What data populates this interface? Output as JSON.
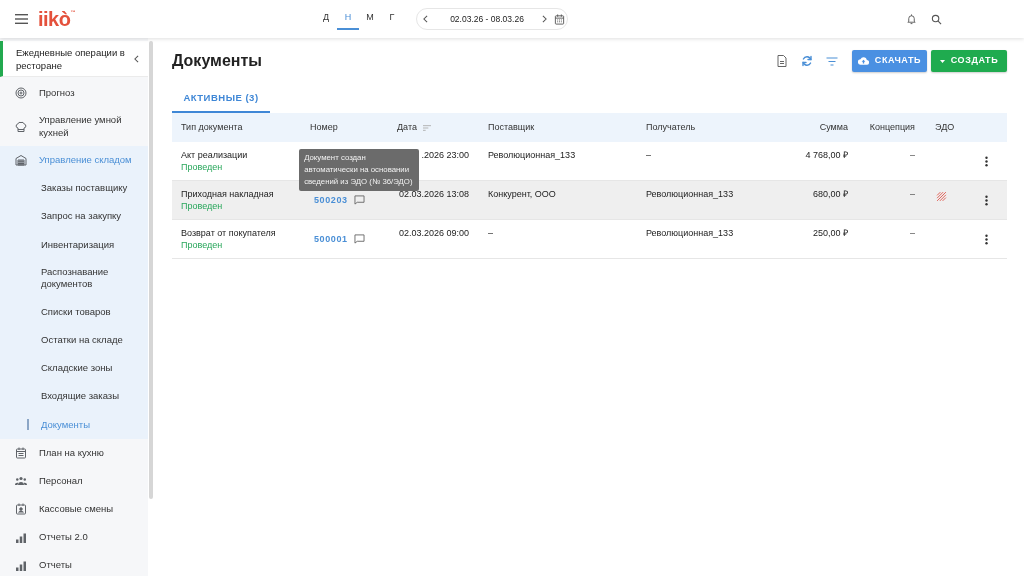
{
  "header": {
    "logo": "iikò",
    "logo_mark": "™",
    "periods": [
      {
        "label": "Д",
        "selected": false
      },
      {
        "label": "Н",
        "selected": true
      },
      {
        "label": "М",
        "selected": false
      },
      {
        "label": "Г",
        "selected": false
      }
    ],
    "date_range": "02.03.26 - 08.03.26"
  },
  "sidebar": {
    "title": "Ежедневные операции в ресторане",
    "items": [
      {
        "label": "Прогноз",
        "selected": false
      },
      {
        "label": "Управление умной кухней",
        "selected": false
      },
      {
        "label": "Управление складом",
        "selected": true,
        "children": [
          {
            "label": "Заказы поставщику",
            "selected": false
          },
          {
            "label": "Запрос на закупку",
            "selected": false
          },
          {
            "label": "Инвентаризация",
            "selected": false
          },
          {
            "label": "Распознавание документов",
            "selected": false
          },
          {
            "label": "Списки товаров",
            "selected": false
          },
          {
            "label": "Остатки на складе",
            "selected": false
          },
          {
            "label": "Складские зоны",
            "selected": false
          },
          {
            "label": "Входящие заказы",
            "selected": false
          },
          {
            "label": "Документы",
            "selected": true
          }
        ]
      },
      {
        "label": "План на кухню",
        "selected": false
      },
      {
        "label": "Персонал",
        "selected": false
      },
      {
        "label": "Кассовые смены",
        "selected": false
      },
      {
        "label": "Отчеты 2.0",
        "selected": false
      },
      {
        "label": "Отчеты",
        "selected": false
      }
    ]
  },
  "page": {
    "title": "Документы",
    "buttons": [
      {
        "label": "СКАЧАТЬ",
        "kind": "download"
      },
      {
        "label": "СОЗДАТЬ",
        "kind": "create"
      }
    ],
    "tabs": [
      {
        "label": "АКТИВНЫЕ (3)",
        "selected": true
      }
    ]
  },
  "table": {
    "columns": [
      {
        "label": "Тип документа",
        "sorted": false
      },
      {
        "label": "Номер",
        "sorted": false
      },
      {
        "label": "Дата",
        "sorted": true
      },
      {
        "label": "Поставщик",
        "sorted": false
      },
      {
        "label": "Получатель",
        "sorted": false
      },
      {
        "label": "Сумма",
        "sorted": false
      },
      {
        "label": "Концепция",
        "sorted": false
      },
      {
        "label": "ЭДО",
        "sorted": false
      }
    ],
    "rows": [
      {
        "type": "Акт реализации",
        "status": "Проведен",
        "comment": false,
        "date": ".2026 23:00",
        "supplier": "Революционная_133",
        "recipient": "–",
        "sum": "4 768,00 ₽",
        "concept": "–",
        "edo": false,
        "highlighted": false
      },
      {
        "type": "Приходная накладная",
        "status": "Проведен",
        "number": "500203",
        "comment": true,
        "tooltip": "Документ создан автоматически на основании сведений из ЭДО (№ 36/ЭДО)",
        "date": "02.03.2026 13:08",
        "supplier": "Конкурент, ООО",
        "recipient": "Революционная_133",
        "sum": "680,00 ₽",
        "concept": "–",
        "edo": true,
        "highlighted": true
      },
      {
        "type": "Возврат от покупателя",
        "status": "Проведен",
        "number": "500001",
        "comment": true,
        "date": "02.03.2026 09:00",
        "supplier": "–",
        "recipient": "Революционная_133",
        "sum": "250,00 ₽",
        "concept": "–",
        "edo": false,
        "highlighted": false
      }
    ]
  }
}
